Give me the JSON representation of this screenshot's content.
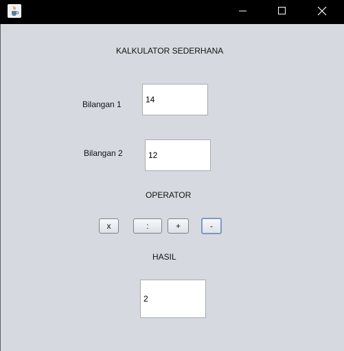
{
  "titlebar": {
    "icons": {
      "app": "java-cup-icon",
      "minimize": "minimize-icon",
      "maximize": "maximize-icon",
      "close": "close-icon"
    }
  },
  "form": {
    "title": "KALKULATOR SEDERHANA",
    "bilangan1_label": "Bilangan 1",
    "bilangan1_value": "14",
    "bilangan2_label": "Bilangan 2",
    "bilangan2_value": "12",
    "operator_label": "OPERATOR",
    "operators": {
      "multiply": "x",
      "divide": ":",
      "add": "+",
      "subtract": "-"
    },
    "selected_operator": "-",
    "hasil_label": "HASIL",
    "hasil_value": "2"
  },
  "colors": {
    "titlebar_bg": "#000000",
    "window_bg": "#d6d9e0",
    "focus_border": "#7a98c4"
  }
}
